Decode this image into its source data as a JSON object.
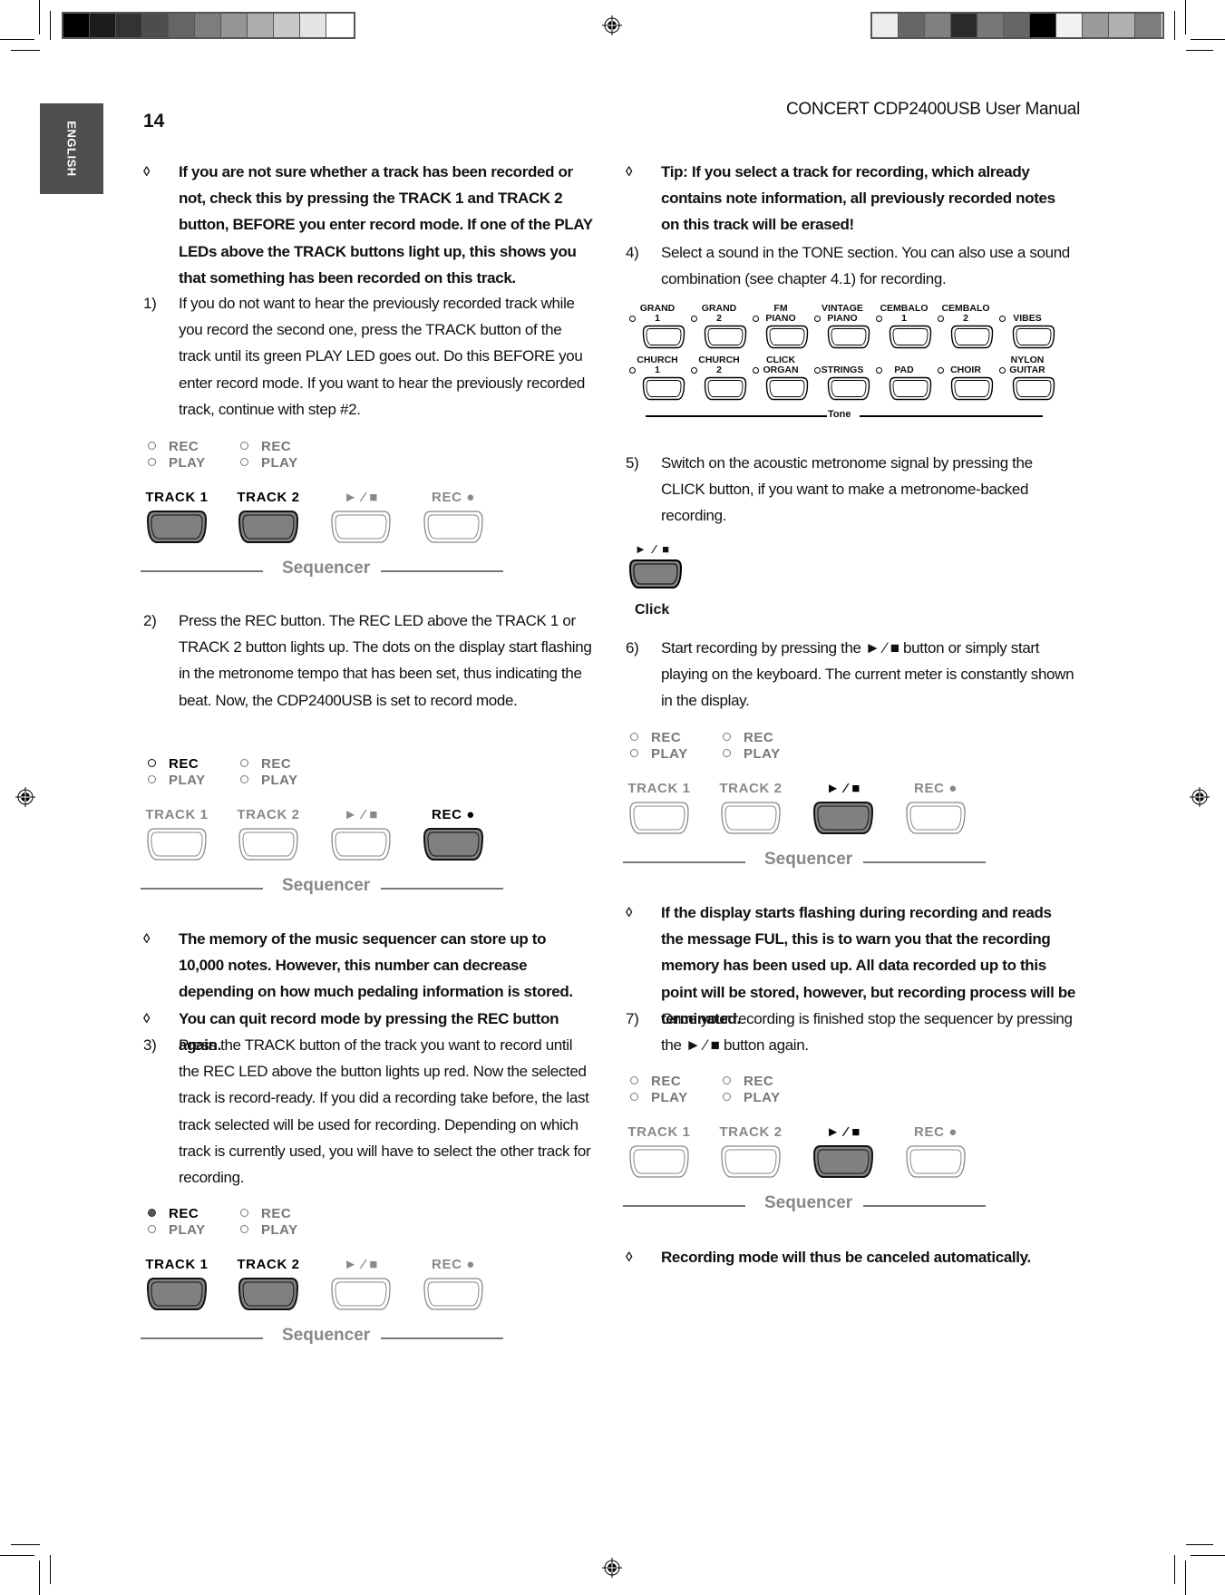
{
  "page": {
    "number": "14",
    "language_tab": "ENGLISH",
    "header_title": "CONCERT CDP2400USB User Manual",
    "print_marks": {
      "color_bar_left": [
        "#000000",
        "#1c1c1c",
        "#333333",
        "#4d4d4d",
        "#656565",
        "#7d7d7d",
        "#959595",
        "#adadad",
        "#c8c8c8",
        "#e4e4e4",
        "#ffffff"
      ],
      "color_bar_right": [
        "#ececec",
        "#666666",
        "#808080",
        "#2b2b2b",
        "#777777",
        "#666666",
        "#000000",
        "#f2f2f2",
        "#9a9a9a",
        "#b0b0b0",
        "#7e7e7e"
      ]
    }
  },
  "left_column": {
    "blocks": [
      {
        "marker": "◊",
        "bold": true,
        "text": "If you are not sure whether a track has been recorded or not, check this by pressing the TRACK 1 and TRACK 2 button, BEFORE you enter record mode. If one of the PLAY LEDs above the TRACK buttons light up, this shows you that something has been recorded on this track."
      },
      {
        "marker": "1)",
        "bold": false,
        "text": "If you do not want to hear the previously recorded track while you record the second one, press the TRACK button of the track until its green PLAY LED goes out. Do this BEFORE you enter record mode. If you want to hear the previously recorded track, continue with step #2."
      },
      {
        "marker": "2)",
        "bold": false,
        "text": "Press the REC button. The REC LED above the TRACK 1 or TRACK 2 button lights up. The dots on the display start flashing in the metronome tempo that has been set, thus indicating the beat. Now, the CDP2400USB is set to record mode."
      },
      {
        "marker": "◊",
        "bold": true,
        "text": "The memory of the music sequencer can store up to 10,000 notes. However, this number can decrease depending on how much pedaling information is stored."
      },
      {
        "marker": "◊",
        "bold": true,
        "text": "You can quit record mode by pressing the REC button again."
      },
      {
        "marker": "3)",
        "bold": false,
        "text": "Press the TRACK button of the track you want to record until the REC LED above the button lights up red. Now the selected track is record-ready. If you did a recording take before, the last track selected will be used for recording. Depending on which track is currently used, you will have to select the other track for recording."
      }
    ]
  },
  "right_column": {
    "blocks": [
      {
        "marker": "◊",
        "bold": true,
        "text": "Tip: If you select a track for recording, which already contains note information, all previously recorded notes on this track will be erased!"
      },
      {
        "marker": "4)",
        "bold": false,
        "text": "Select a sound in the TONE section. You can also use a sound combination (see chapter 4.1) for recording."
      },
      {
        "marker": "5)",
        "bold": false,
        "text": "Switch on the acoustic metronome signal by pressing the CLICK button, if you want to make a metronome-backed recording."
      },
      {
        "marker": "6)",
        "bold": false,
        "text": "Start recording by pressing the ► ⁄ ■ button or simply start playing on the keyboard. The current meter is constantly shown in the display."
      },
      {
        "marker": "◊",
        "bold": true,
        "text": "If the display starts flashing during recording and reads the message FUL, this is to warn you that the recording memory has been used up. All data recorded up to this point will be stored, however, but recording process will be terminated."
      },
      {
        "marker": "7)",
        "bold": false,
        "text": "Once your recording is finished stop the sequencer by pressing the ► ⁄ ■ button again."
      },
      {
        "marker": "◊",
        "bold": true,
        "text": "Recording mode will thus be canceled automatically."
      }
    ]
  },
  "sequencer_panel": {
    "rec_label": "REC",
    "play_label": "PLAY",
    "track1_label": "TRACK 1",
    "track2_label": "TRACK 2",
    "playstop_label": "► ⁄ ■",
    "rec_button_label": "REC ●",
    "section_label": "Sequencer"
  },
  "sequencer_states": [
    {
      "id": "fig1",
      "pressed": [
        "track1",
        "track2"
      ],
      "rec1_led": "off"
    },
    {
      "id": "fig2",
      "pressed": [
        "rec"
      ],
      "rec1_led": "outline"
    },
    {
      "id": "fig3",
      "pressed": [
        "track1",
        "track2"
      ],
      "rec1_led": "lit"
    },
    {
      "id": "fig4",
      "pressed": [
        "playstop"
      ],
      "rec1_led": "off"
    },
    {
      "id": "fig5",
      "pressed": [
        "playstop"
      ],
      "rec1_led": "off"
    }
  ],
  "tone_panel": {
    "section_label": "Tone",
    "row1": [
      {
        "l1": "GRAND",
        "l2": "1"
      },
      {
        "l1": "GRAND",
        "l2": "2"
      },
      {
        "l1": "FM",
        "l2": "PIANO"
      },
      {
        "l1": "VINTAGE",
        "l2": "PIANO"
      },
      {
        "l1": "CEMBALO",
        "l2": "1"
      },
      {
        "l1": "CEMBALO",
        "l2": "2"
      },
      {
        "l1": "",
        "l2": "VIBES"
      }
    ],
    "row2": [
      {
        "l1": "CHURCH",
        "l2": "1"
      },
      {
        "l1": "CHURCH",
        "l2": "2"
      },
      {
        "l1": "CLICK",
        "l2": "ORGAN"
      },
      {
        "l1": "",
        "l2": "STRINGS"
      },
      {
        "l1": "",
        "l2": "PAD"
      },
      {
        "l1": "",
        "l2": "CHOIR"
      },
      {
        "l1": "NYLON",
        "l2": "GUITAR"
      }
    ]
  },
  "click_panel": {
    "symbol": "► ⁄ ■",
    "label": "Click"
  }
}
